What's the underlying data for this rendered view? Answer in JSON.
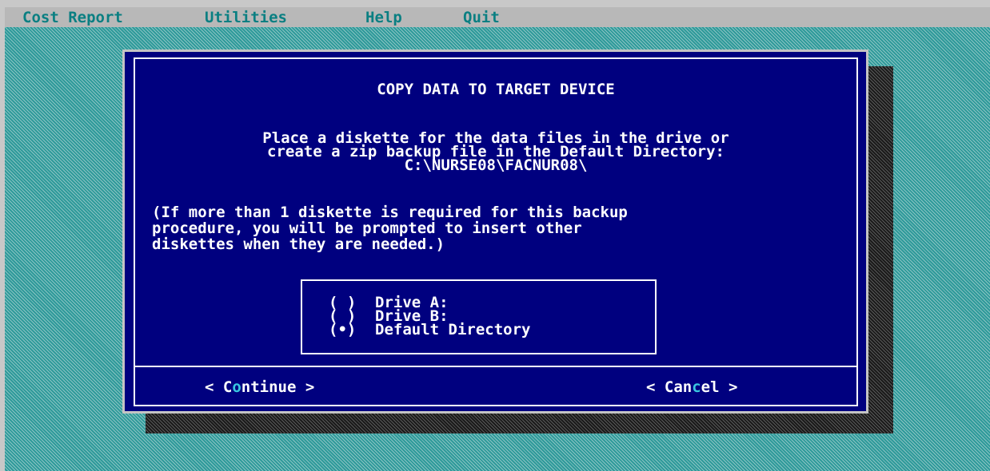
{
  "menubar": {
    "items": [
      {
        "label": "Cost Report"
      },
      {
        "label": "Utilities"
      },
      {
        "label": "Help"
      },
      {
        "label": "Quit"
      }
    ]
  },
  "dialog": {
    "title": "COPY DATA TO TARGET DEVICE",
    "instructions": [
      "Place a diskette for the data files in the drive or",
      "create a zip backup file in the Default Directory:",
      "C:\\NURSE08\\FACNUR08\\"
    ],
    "note": [
      "(If more than 1 diskette is required for this backup",
      "procedure, you will be prompted to insert other",
      "diskettes when they are needed.)"
    ],
    "options": [
      {
        "mark": "( )",
        "label": "Drive A:"
      },
      {
        "mark": "( )",
        "label": "Drive B:"
      },
      {
        "mark": "(•)",
        "label": "Default Directory"
      }
    ],
    "selected_option": "Default Directory",
    "buttons": {
      "continue": {
        "open": "< ",
        "pre": "C",
        "hotkey": "o",
        "post": "ntinue",
        "close": " >"
      },
      "cancel": {
        "open": "< ",
        "pre": "Can",
        "hotkey": "c",
        "post": "el",
        "close": " >"
      }
    }
  },
  "colors": {
    "desktop": "#2e9a9a",
    "dialog_background": "#00007f",
    "menubar_background": "#b8b8b8",
    "menu_text": "#0a7f82",
    "hotkey": "#39c8e0",
    "text": "#ffffff"
  }
}
